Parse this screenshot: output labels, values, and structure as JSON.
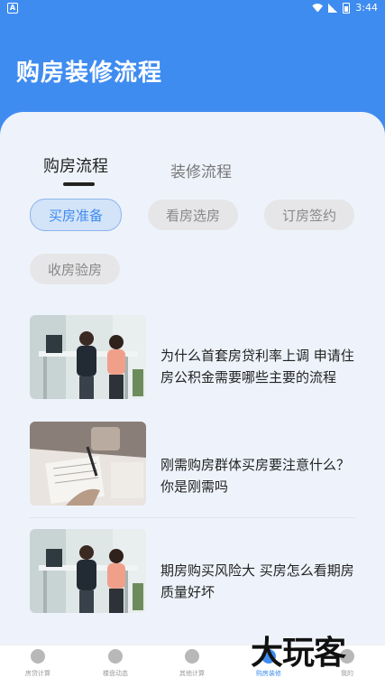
{
  "status": {
    "left_icon": "A",
    "time": "3:44"
  },
  "header": {
    "title": "购房装修流程"
  },
  "tabs": [
    {
      "label": "购房流程",
      "active": true
    },
    {
      "label": "装修流程",
      "active": false
    }
  ],
  "chips": [
    {
      "label": "买房准备",
      "active": true
    },
    {
      "label": "看房选房",
      "active": false
    },
    {
      "label": "订房签约",
      "active": false
    },
    {
      "label": "收房验房",
      "active": false
    }
  ],
  "articles": [
    {
      "title": "为什么首套房贷利率上调 申请住房公积金需要哪些主要的流程",
      "image": "office-meeting-photo"
    },
    {
      "title": "刚需购房群体买房要注意什么？你是刚需吗",
      "image": "signing-contract-photo"
    },
    {
      "title": "期房购买风险大 买房怎么看期房质量好坏",
      "image": "office-meeting-photo"
    }
  ],
  "bottom_nav": [
    {
      "label": "房贷计算",
      "icon": "home-icon",
      "active": false
    },
    {
      "label": "楼盘动态",
      "icon": "upload-icon",
      "active": false
    },
    {
      "label": "其他计算",
      "icon": "layers-icon",
      "active": false
    },
    {
      "label": "购房装修",
      "icon": "pin-icon",
      "active": true
    },
    {
      "label": "我的",
      "icon": "user-icon",
      "active": false
    }
  ],
  "watermark": "大玩客",
  "colors": {
    "primary": "#3f8cf0",
    "panel": "#eef3fb"
  }
}
